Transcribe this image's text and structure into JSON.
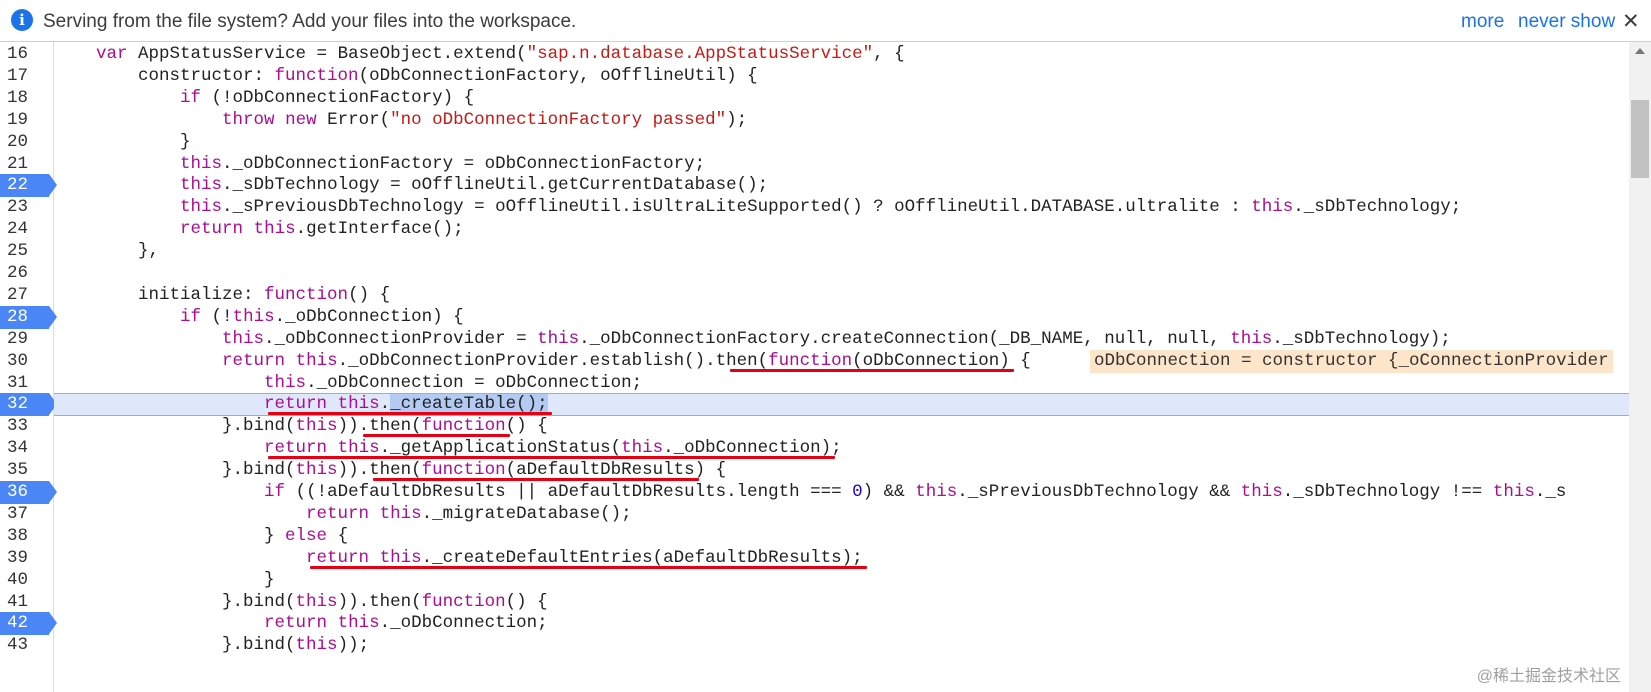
{
  "infobar": {
    "message": "Serving from the file system? Add your files into the workspace.",
    "more_link": "more",
    "never_show_link": "never show",
    "close_symbol": "✕"
  },
  "watermark": "@稀土掘金技术社区",
  "code": {
    "current_line": 32,
    "breakpoints": [
      22,
      28,
      32,
      36,
      42
    ],
    "lines": [
      {
        "n": 16,
        "text": "    var AppStatusService = BaseObject.extend(\"sap.n.database.AppStatusService\", {"
      },
      {
        "n": 17,
        "text": "        constructor: function(oDbConnectionFactory, oOfflineUtil) {"
      },
      {
        "n": 18,
        "text": "            if (!oDbConnectionFactory) {"
      },
      {
        "n": 19,
        "text": "                throw new Error(\"no oDbConnectionFactory passed\");"
      },
      {
        "n": 20,
        "text": "            }"
      },
      {
        "n": 21,
        "text": "            this._oDbConnectionFactory = oDbConnectionFactory;"
      },
      {
        "n": 22,
        "text": "            this._sDbTechnology = oOfflineUtil.getCurrentDatabase();"
      },
      {
        "n": 23,
        "text": "            this._sPreviousDbTechnology = oOfflineUtil.isUltraLiteSupported() ? oOfflineUtil.DATABASE.ultralite : this._sDbTechnology;"
      },
      {
        "n": 24,
        "text": "            return this.getInterface();"
      },
      {
        "n": 25,
        "text": "        },"
      },
      {
        "n": 26,
        "text": ""
      },
      {
        "n": 27,
        "text": "        initialize: function() {"
      },
      {
        "n": 28,
        "text": "            if (!this._oDbConnection) {"
      },
      {
        "n": 29,
        "text": "                this._oDbConnectionProvider = this._oDbConnectionFactory.createConnection(_DB_NAME, null, null, this._sDbTechnology);"
      },
      {
        "n": 30,
        "text": "                return this._oDbConnectionProvider.establish().then(function(oDbConnection) {"
      },
      {
        "n": 31,
        "text": "                    this._oDbConnection = oDbConnection;"
      },
      {
        "n": 32,
        "text": "                    return this._createTable();"
      },
      {
        "n": 33,
        "text": "                }.bind(this)).then(function() {"
      },
      {
        "n": 34,
        "text": "                    return this._getApplicationStatus(this._oDbConnection);"
      },
      {
        "n": 35,
        "text": "                }.bind(this)).then(function(aDefaultDbResults) {"
      },
      {
        "n": 36,
        "text": "                    if ((!aDefaultDbResults || aDefaultDbResults.length === 0) && this._sPreviousDbTechnology && this._sDbTechnology !== this._s"
      },
      {
        "n": 37,
        "text": "                        return this._migrateDatabase();"
      },
      {
        "n": 38,
        "text": "                    } else {"
      },
      {
        "n": 39,
        "text": "                        return this._createDefaultEntries(aDefaultDbResults);"
      },
      {
        "n": 40,
        "text": "                    }"
      },
      {
        "n": 41,
        "text": "                }.bind(this)).then(function() {"
      },
      {
        "n": 42,
        "text": "                    return this._oDbConnection;"
      },
      {
        "n": 43,
        "text": "                }.bind(this));"
      }
    ],
    "inline_value": "oDbConnection = constructor {_oConnectionProvider"
  },
  "colors": {
    "keyword": "#aa0d91",
    "string": "#c41a16",
    "number": "#1c00cf",
    "breakpoint": "#4a86f5",
    "annotation_underline": "#e60012"
  }
}
